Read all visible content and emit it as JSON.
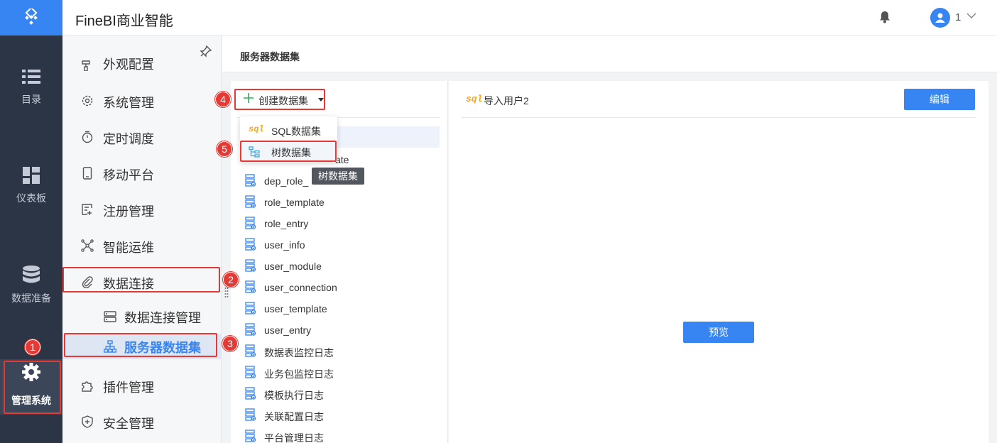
{
  "app": {
    "title": "FineBI商业智能"
  },
  "user": {
    "name": "1"
  },
  "rail": {
    "items": [
      {
        "label": "目录",
        "icon": "list-icon"
      },
      {
        "label": "仪表板",
        "icon": "dashboard-icon"
      },
      {
        "label": "数据准备",
        "icon": "database-icon"
      },
      {
        "label": "管理系统",
        "icon": "gear-icon",
        "active": true
      }
    ]
  },
  "subnav": {
    "items": [
      {
        "label": "外观配置",
        "icon": "appearance-icon"
      },
      {
        "label": "系统管理",
        "icon": "gear-outline-icon"
      },
      {
        "label": "定时调度",
        "icon": "timer-icon"
      },
      {
        "label": "移动平台",
        "icon": "mobile-icon"
      },
      {
        "label": "注册管理",
        "icon": "register-icon"
      },
      {
        "label": "智能运维",
        "icon": "ops-icon"
      },
      {
        "label": "数据连接",
        "icon": "paperclip-icon"
      },
      {
        "label": "插件管理",
        "icon": "puzzle-icon"
      },
      {
        "label": "安全管理",
        "icon": "shield-icon"
      }
    ],
    "subitems": [
      {
        "label": "数据连接管理",
        "icon": "server-icon"
      },
      {
        "label": "服务器数据集",
        "icon": "hierarchy-icon",
        "active": true
      }
    ]
  },
  "page": {
    "title": "服务器数据集"
  },
  "toolbar": {
    "create_label": "创建数据集"
  },
  "dropdown": {
    "items": [
      {
        "label": "SQL数据集",
        "badge": "sql"
      },
      {
        "label": "树数据集"
      }
    ],
    "tooltip": "树数据集"
  },
  "tree": {
    "partial_label": "ate",
    "items": [
      "dep_role_",
      "role_template",
      "role_entry",
      "user_info",
      "user_module",
      "user_connection",
      "user_template",
      "user_entry",
      "数据表监控日志",
      "业务包监控日志",
      "模板执行日志",
      "关联配置日志",
      "平台管理日志"
    ]
  },
  "detail": {
    "badge": "sql",
    "dataset_name": "导入用户2",
    "edit_label": "编辑",
    "preview_label": "预览"
  },
  "annotations": [
    "1",
    "2",
    "3",
    "4",
    "5"
  ],
  "colors": {
    "accent": "#3685f2",
    "rail_bg": "#2b3546",
    "annotation": "#e53935",
    "sql_badge": "#f5a623"
  }
}
